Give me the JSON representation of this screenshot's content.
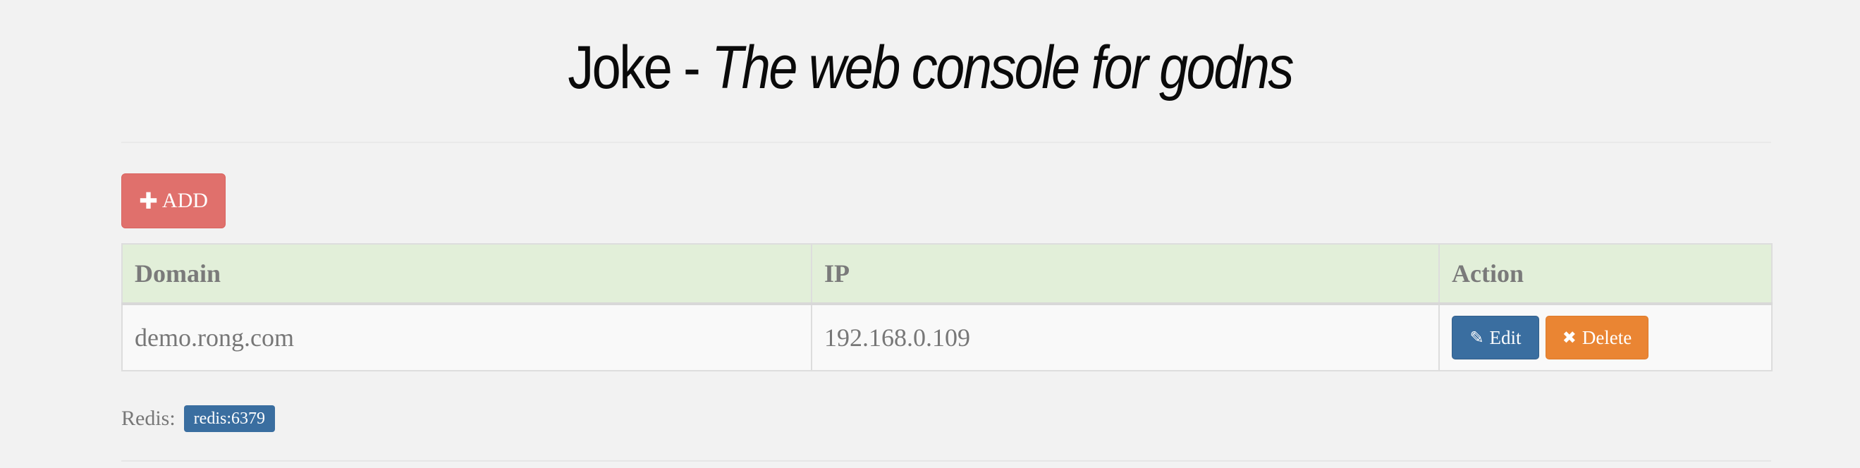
{
  "header": {
    "app_name": "Joke",
    "separator": " - ",
    "tagline": "The web console for godns"
  },
  "toolbar": {
    "add_icon": "plus-icon",
    "add_label": "ADD"
  },
  "table": {
    "columns": [
      "Domain",
      "IP",
      "Action"
    ],
    "rows": [
      {
        "domain": "demo.rong.com",
        "ip": "192.168.0.109",
        "edit_label": "Edit",
        "delete_label": "Delete"
      }
    ]
  },
  "footer": {
    "redis_label": "Redis:",
    "redis_value": "redis:6379"
  },
  "colors": {
    "background": "#f2f2f2",
    "add_button": "#e0706c",
    "table_header": "#e2efd9",
    "edit_button": "#3a6ea0",
    "delete_button": "#ea8533",
    "badge": "#3a6ea0"
  },
  "icons": {
    "add": "plus-icon",
    "edit": "edit-icon",
    "delete": "close-icon"
  }
}
